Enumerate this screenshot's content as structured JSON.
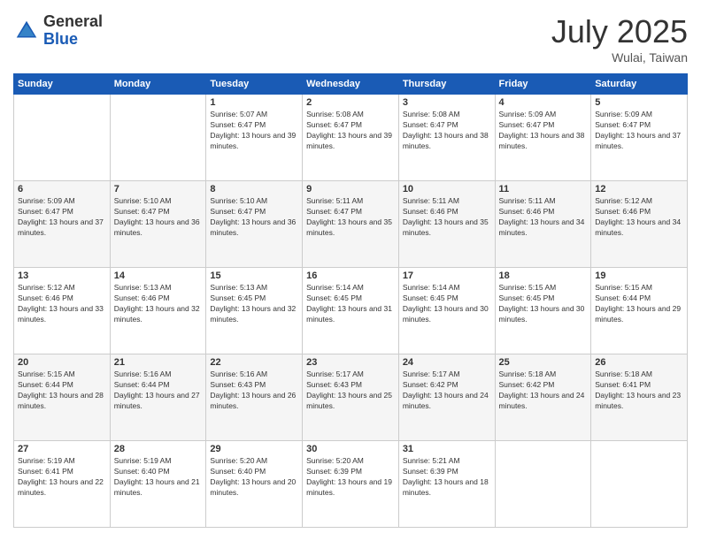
{
  "header": {
    "logo_general": "General",
    "logo_blue": "Blue",
    "month_year": "July 2025",
    "location": "Wulai, Taiwan"
  },
  "days_of_week": [
    "Sunday",
    "Monday",
    "Tuesday",
    "Wednesday",
    "Thursday",
    "Friday",
    "Saturday"
  ],
  "weeks": [
    [
      {
        "day": "",
        "info": ""
      },
      {
        "day": "",
        "info": ""
      },
      {
        "day": "1",
        "info": "Sunrise: 5:07 AM\nSunset: 6:47 PM\nDaylight: 13 hours and 39 minutes."
      },
      {
        "day": "2",
        "info": "Sunrise: 5:08 AM\nSunset: 6:47 PM\nDaylight: 13 hours and 39 minutes."
      },
      {
        "day": "3",
        "info": "Sunrise: 5:08 AM\nSunset: 6:47 PM\nDaylight: 13 hours and 38 minutes."
      },
      {
        "day": "4",
        "info": "Sunrise: 5:09 AM\nSunset: 6:47 PM\nDaylight: 13 hours and 38 minutes."
      },
      {
        "day": "5",
        "info": "Sunrise: 5:09 AM\nSunset: 6:47 PM\nDaylight: 13 hours and 37 minutes."
      }
    ],
    [
      {
        "day": "6",
        "info": "Sunrise: 5:09 AM\nSunset: 6:47 PM\nDaylight: 13 hours and 37 minutes."
      },
      {
        "day": "7",
        "info": "Sunrise: 5:10 AM\nSunset: 6:47 PM\nDaylight: 13 hours and 36 minutes."
      },
      {
        "day": "8",
        "info": "Sunrise: 5:10 AM\nSunset: 6:47 PM\nDaylight: 13 hours and 36 minutes."
      },
      {
        "day": "9",
        "info": "Sunrise: 5:11 AM\nSunset: 6:47 PM\nDaylight: 13 hours and 35 minutes."
      },
      {
        "day": "10",
        "info": "Sunrise: 5:11 AM\nSunset: 6:46 PM\nDaylight: 13 hours and 35 minutes."
      },
      {
        "day": "11",
        "info": "Sunrise: 5:11 AM\nSunset: 6:46 PM\nDaylight: 13 hours and 34 minutes."
      },
      {
        "day": "12",
        "info": "Sunrise: 5:12 AM\nSunset: 6:46 PM\nDaylight: 13 hours and 34 minutes."
      }
    ],
    [
      {
        "day": "13",
        "info": "Sunrise: 5:12 AM\nSunset: 6:46 PM\nDaylight: 13 hours and 33 minutes."
      },
      {
        "day": "14",
        "info": "Sunrise: 5:13 AM\nSunset: 6:46 PM\nDaylight: 13 hours and 32 minutes."
      },
      {
        "day": "15",
        "info": "Sunrise: 5:13 AM\nSunset: 6:45 PM\nDaylight: 13 hours and 32 minutes."
      },
      {
        "day": "16",
        "info": "Sunrise: 5:14 AM\nSunset: 6:45 PM\nDaylight: 13 hours and 31 minutes."
      },
      {
        "day": "17",
        "info": "Sunrise: 5:14 AM\nSunset: 6:45 PM\nDaylight: 13 hours and 30 minutes."
      },
      {
        "day": "18",
        "info": "Sunrise: 5:15 AM\nSunset: 6:45 PM\nDaylight: 13 hours and 30 minutes."
      },
      {
        "day": "19",
        "info": "Sunrise: 5:15 AM\nSunset: 6:44 PM\nDaylight: 13 hours and 29 minutes."
      }
    ],
    [
      {
        "day": "20",
        "info": "Sunrise: 5:15 AM\nSunset: 6:44 PM\nDaylight: 13 hours and 28 minutes."
      },
      {
        "day": "21",
        "info": "Sunrise: 5:16 AM\nSunset: 6:44 PM\nDaylight: 13 hours and 27 minutes."
      },
      {
        "day": "22",
        "info": "Sunrise: 5:16 AM\nSunset: 6:43 PM\nDaylight: 13 hours and 26 minutes."
      },
      {
        "day": "23",
        "info": "Sunrise: 5:17 AM\nSunset: 6:43 PM\nDaylight: 13 hours and 25 minutes."
      },
      {
        "day": "24",
        "info": "Sunrise: 5:17 AM\nSunset: 6:42 PM\nDaylight: 13 hours and 24 minutes."
      },
      {
        "day": "25",
        "info": "Sunrise: 5:18 AM\nSunset: 6:42 PM\nDaylight: 13 hours and 24 minutes."
      },
      {
        "day": "26",
        "info": "Sunrise: 5:18 AM\nSunset: 6:41 PM\nDaylight: 13 hours and 23 minutes."
      }
    ],
    [
      {
        "day": "27",
        "info": "Sunrise: 5:19 AM\nSunset: 6:41 PM\nDaylight: 13 hours and 22 minutes."
      },
      {
        "day": "28",
        "info": "Sunrise: 5:19 AM\nSunset: 6:40 PM\nDaylight: 13 hours and 21 minutes."
      },
      {
        "day": "29",
        "info": "Sunrise: 5:20 AM\nSunset: 6:40 PM\nDaylight: 13 hours and 20 minutes."
      },
      {
        "day": "30",
        "info": "Sunrise: 5:20 AM\nSunset: 6:39 PM\nDaylight: 13 hours and 19 minutes."
      },
      {
        "day": "31",
        "info": "Sunrise: 5:21 AM\nSunset: 6:39 PM\nDaylight: 13 hours and 18 minutes."
      },
      {
        "day": "",
        "info": ""
      },
      {
        "day": "",
        "info": ""
      }
    ]
  ]
}
